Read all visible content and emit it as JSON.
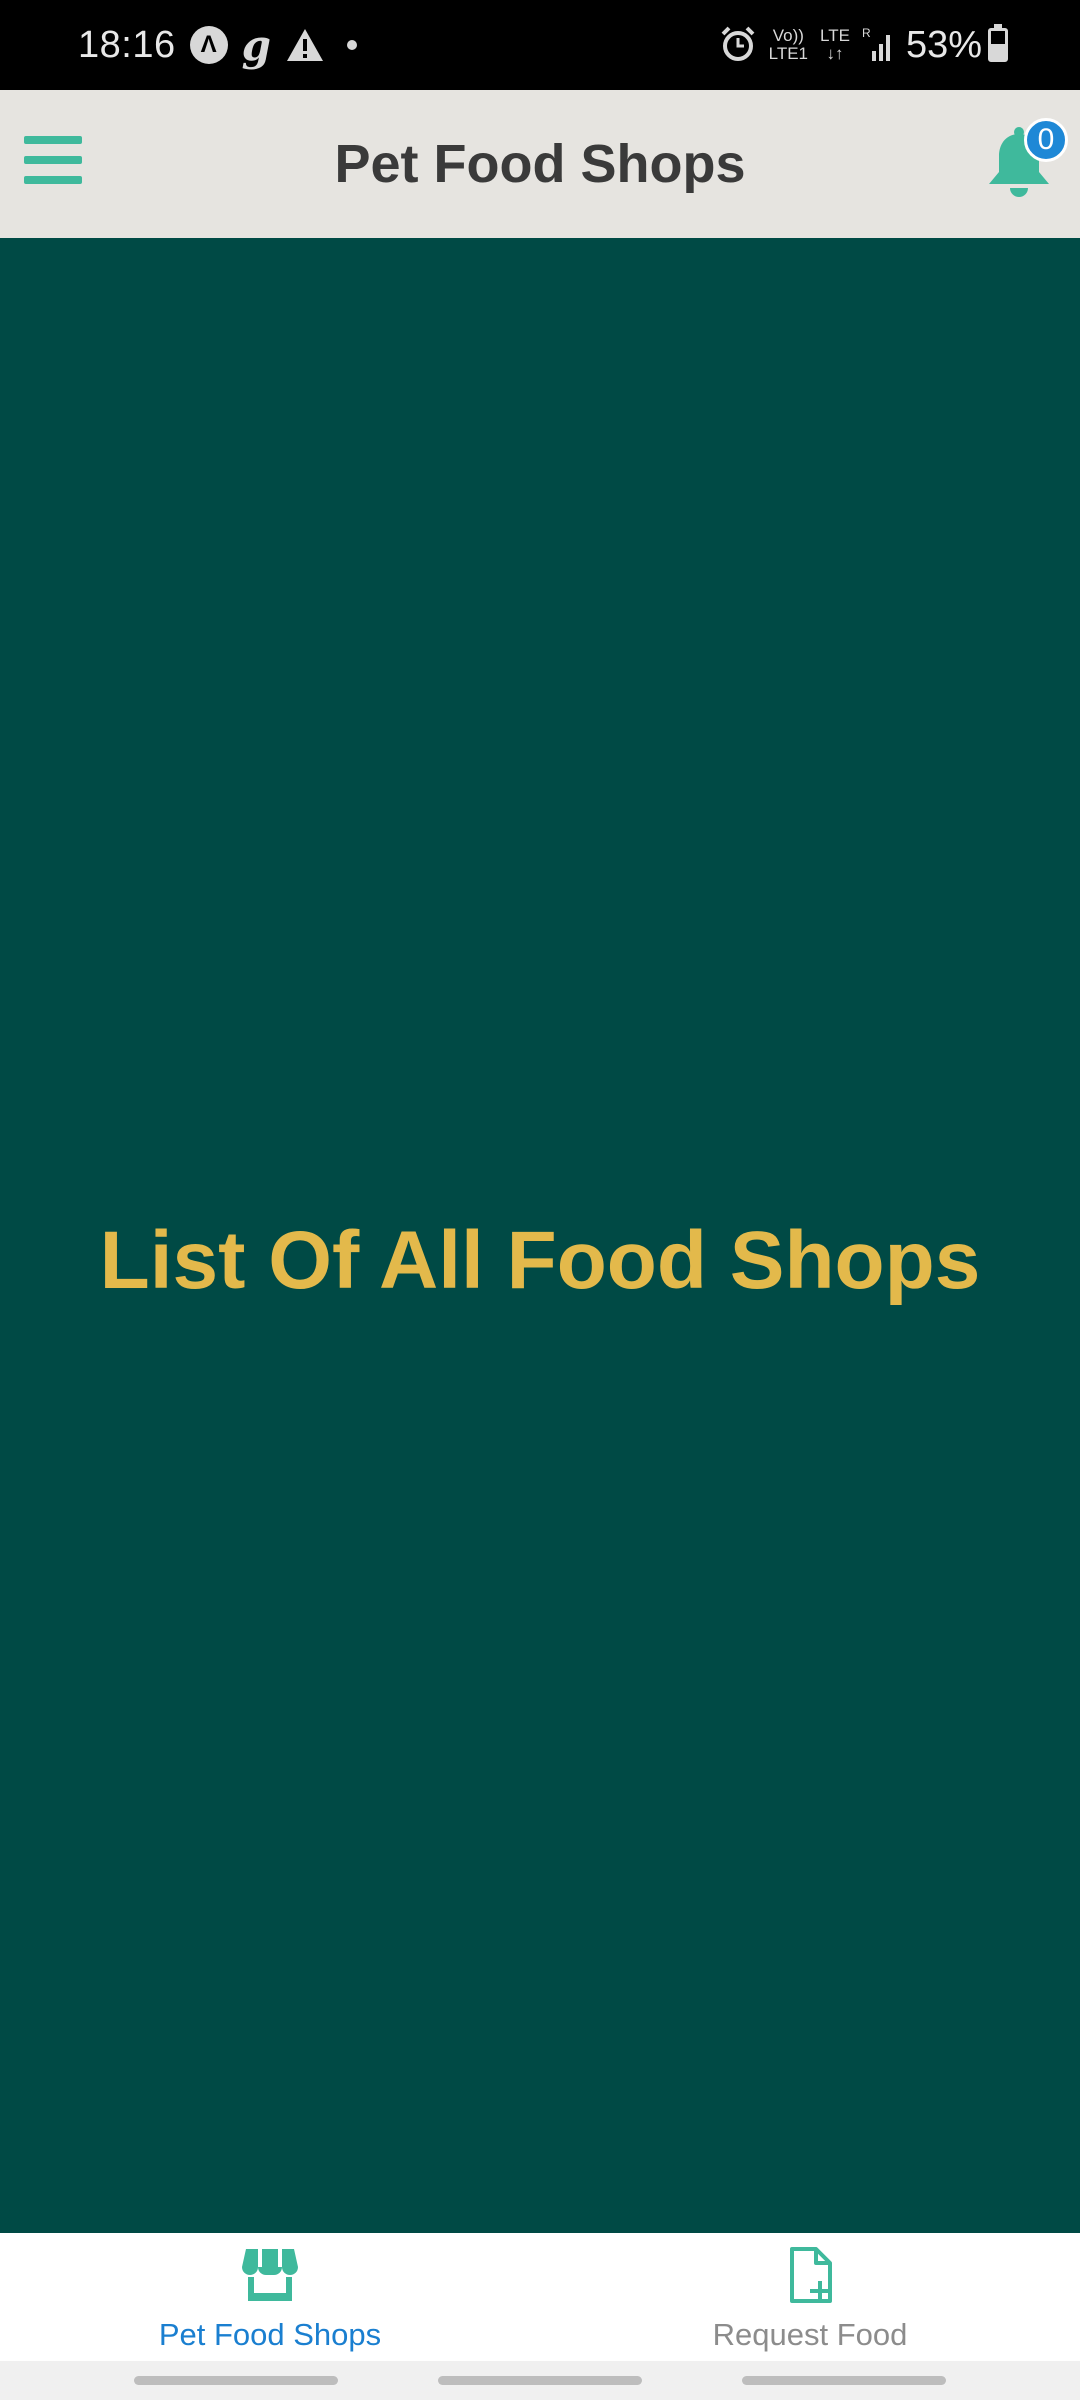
{
  "status_bar": {
    "time": "18:16",
    "battery": "53%",
    "battery_level": 0.53,
    "icons": [
      "app-a-icon",
      "g-app-icon",
      "warning-icon",
      "notification-dot-icon",
      "alarm-icon",
      "volte-icon",
      "lte-icon",
      "signal-icon",
      "battery-icon"
    ],
    "volte_text": "Vo))\nLTE1",
    "lte_text": "LTE\n↓↑"
  },
  "header": {
    "title": "Pet Food Shops",
    "notification_count": "0"
  },
  "main": {
    "heading": "List Of All Food Shops"
  },
  "bottom_nav": {
    "items": [
      {
        "label": "Pet Food Shops",
        "icon": "storefront-icon",
        "active": true
      },
      {
        "label": "Request Food",
        "icon": "file-add-icon",
        "active": false
      }
    ]
  },
  "colors": {
    "accent": "#3fb99c",
    "background": "#004a45",
    "heading": "#e3b94b",
    "active_nav": "#1a7fd0",
    "badge": "#1e88d6"
  }
}
